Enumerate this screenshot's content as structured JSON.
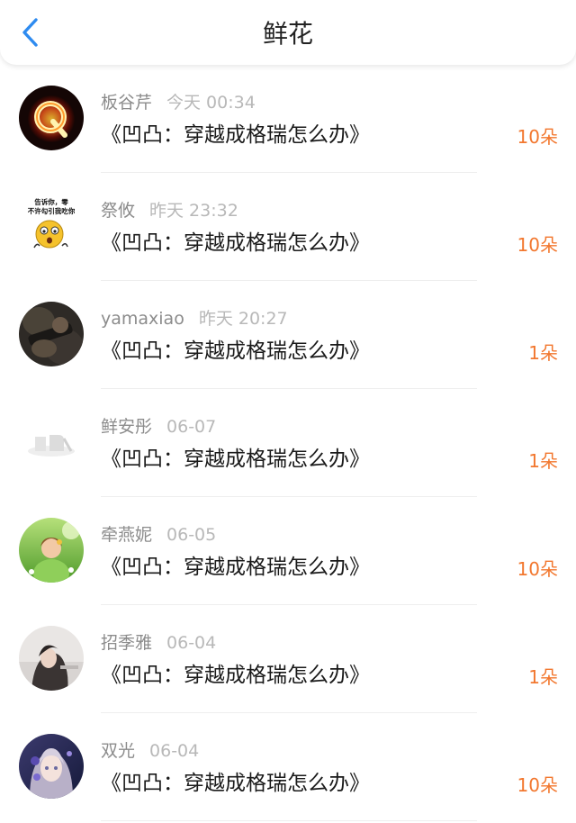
{
  "header": {
    "title": "鲜花",
    "back_icon": "chevron-left-icon",
    "accent_color": "#2e8bf0"
  },
  "items": [
    {
      "username": "板谷芹",
      "time": "今天 00:34",
      "book": "《凹凸：穿越成格瑞怎么办》",
      "count": "10朵",
      "avatar": "fire-letter-q-avatar"
    },
    {
      "username": "祭攸",
      "time": "昨天 23:32",
      "book": "《凹凸：穿越成格瑞怎么办》",
      "count": "10朵",
      "avatar": "meme-emoji-avatar",
      "avatar_text": [
        "告诉你，零",
        "不许勾引我吃你"
      ]
    },
    {
      "username": "yamaxiao",
      "time": "昨天 20:27",
      "book": "《凹凸：穿越成格瑞怎么办》",
      "count": "1朵",
      "avatar": "dark-photo-avatar"
    },
    {
      "username": "鲜安彤",
      "time": "06-07",
      "book": "《凹凸：穿越成格瑞怎么办》",
      "count": "1朵",
      "avatar": "light-sketch-avatar"
    },
    {
      "username": "牵燕妮",
      "time": "06-05",
      "book": "《凹凸：穿越成格瑞怎么办》",
      "count": "10朵",
      "avatar": "girl-in-meadow-avatar"
    },
    {
      "username": "招季雅",
      "time": "06-04",
      "book": "《凹凸：穿越成格瑞怎么办》",
      "count": "1朵",
      "avatar": "girl-portrait-avatar"
    },
    {
      "username": "双光",
      "time": "06-04",
      "book": "《凹凸：穿越成格瑞怎么办》",
      "count": "10朵",
      "avatar": "anime-girl-avatar"
    }
  ],
  "colors": {
    "count": "#f2772e",
    "username": "#8c8c8c",
    "time": "#b8b8b8"
  }
}
